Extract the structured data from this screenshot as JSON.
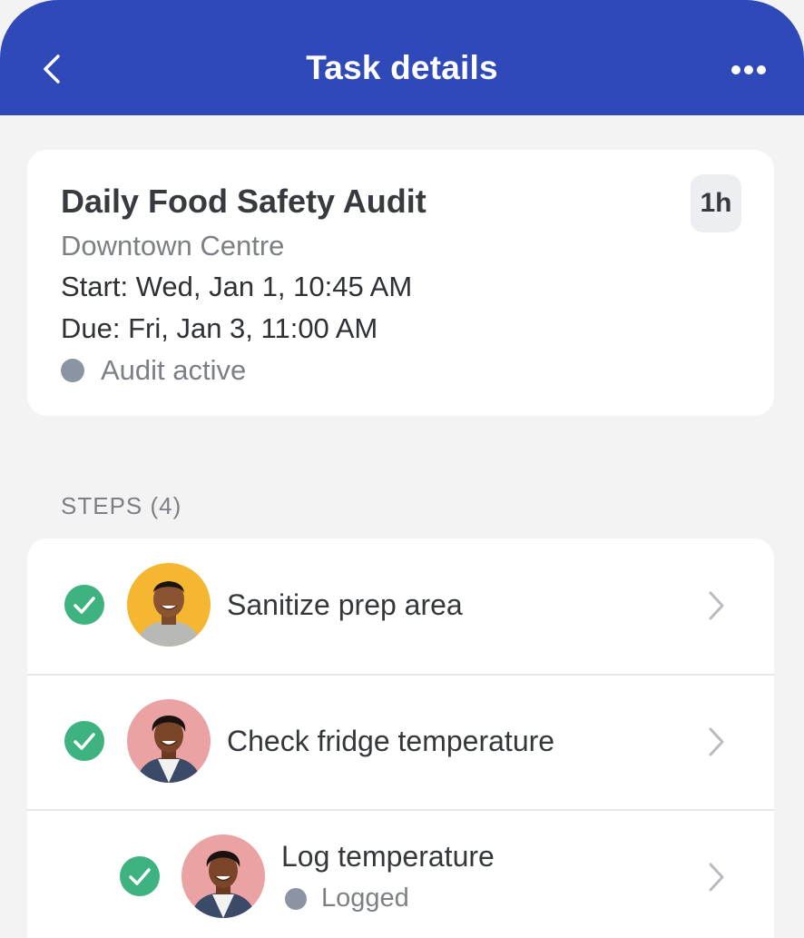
{
  "header": {
    "title": "Task details",
    "back_icon": "chevron-left-icon",
    "more_icon": "more-horizontal-icon",
    "background": "#3049b8"
  },
  "task": {
    "title": "Daily Food Safety Audit",
    "location": "Downtown Centre",
    "start": "Start: Wed, Jan 1, 10:45 AM",
    "due": "Due: Fri, Jan 3, 11:00 AM",
    "status": "Audit active",
    "duration": "1h"
  },
  "steps": {
    "heading": "STEPS (4)",
    "items": [
      {
        "label": "Sanitize prep area",
        "completed": true,
        "avatar_bg": "#f5b731"
      },
      {
        "label": "Check fridge temperature",
        "completed": true,
        "avatar_bg": "#eba2a2"
      },
      {
        "label": "Log temperature",
        "completed": true,
        "sub_status": "Logged",
        "avatar_bg": "#eba2a2"
      }
    ]
  },
  "colors": {
    "accent": "#3049b8",
    "success": "#3fb37f",
    "status_dot": "#8b94a3"
  }
}
